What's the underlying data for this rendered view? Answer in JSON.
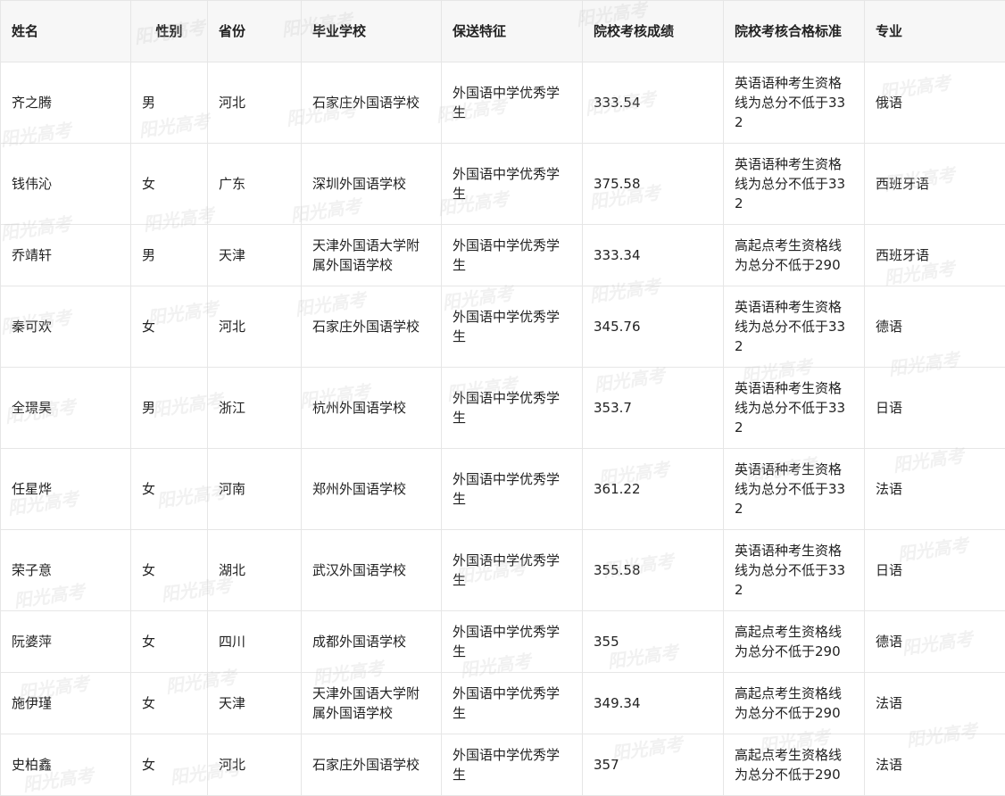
{
  "columns": [
    "姓名",
    "性别",
    "省份",
    "毕业学校",
    "保送特征",
    "院校考核成绩",
    "院校考核合格标准",
    "专业"
  ],
  "rows": [
    {
      "name": "齐之腾",
      "gender": "男",
      "province": "河北",
      "school": "石家庄外国语学校",
      "feature": "外国语中学优秀学生",
      "score": "333.54",
      "standard": "英语语种考生资格线为总分不低于332",
      "major": "俄语"
    },
    {
      "name": "钱伟沁",
      "gender": "女",
      "province": "广东",
      "school": "深圳外国语学校",
      "feature": "外国语中学优秀学生",
      "score": "375.58",
      "standard": "英语语种考生资格线为总分不低于332",
      "major": "西班牙语"
    },
    {
      "name": "乔靖轩",
      "gender": "男",
      "province": "天津",
      "school": "天津外国语大学附属外国语学校",
      "feature": "外国语中学优秀学生",
      "score": "333.34",
      "standard": "高起点考生资格线为总分不低于290",
      "major": "西班牙语"
    },
    {
      "name": "秦可欢",
      "gender": "女",
      "province": "河北",
      "school": "石家庄外国语学校",
      "feature": "外国语中学优秀学生",
      "score": "345.76",
      "standard": "英语语种考生资格线为总分不低于332",
      "major": "德语"
    },
    {
      "name": "全璟昊",
      "gender": "男",
      "province": "浙江",
      "school": "杭州外国语学校",
      "feature": "外国语中学优秀学生",
      "score": "353.7",
      "standard": "英语语种考生资格线为总分不低于332",
      "major": "日语"
    },
    {
      "name": "任星烨",
      "gender": "女",
      "province": "河南",
      "school": "郑州外国语学校",
      "feature": "外国语中学优秀学生",
      "score": "361.22",
      "standard": "英语语种考生资格线为总分不低于332",
      "major": "法语"
    },
    {
      "name": "荣子意",
      "gender": "女",
      "province": "湖北",
      "school": "武汉外国语学校",
      "feature": "外国语中学优秀学生",
      "score": "355.58",
      "standard": "英语语种考生资格线为总分不低于332",
      "major": "日语"
    },
    {
      "name": "阮婆萍",
      "gender": "女",
      "province": "四川",
      "school": "成都外国语学校",
      "feature": "外国语中学优秀学生",
      "score": "355",
      "standard": "高起点考生资格线为总分不低于290",
      "major": "德语"
    },
    {
      "name": "施伊瑾",
      "gender": "女",
      "province": "天津",
      "school": "天津外国语大学附属外国语学校",
      "feature": "外国语中学优秀学生",
      "score": "349.34",
      "standard": "高起点考生资格线为总分不低于290",
      "major": "法语"
    },
    {
      "name": "史柏鑫",
      "gender": "女",
      "province": "河北",
      "school": "石家庄外国语学校",
      "feature": "外国语中学优秀学生",
      "score": "357",
      "standard": "高起点考生资格线为总分不低于290",
      "major": "法语"
    }
  ],
  "watermark_text": "阳光高考"
}
